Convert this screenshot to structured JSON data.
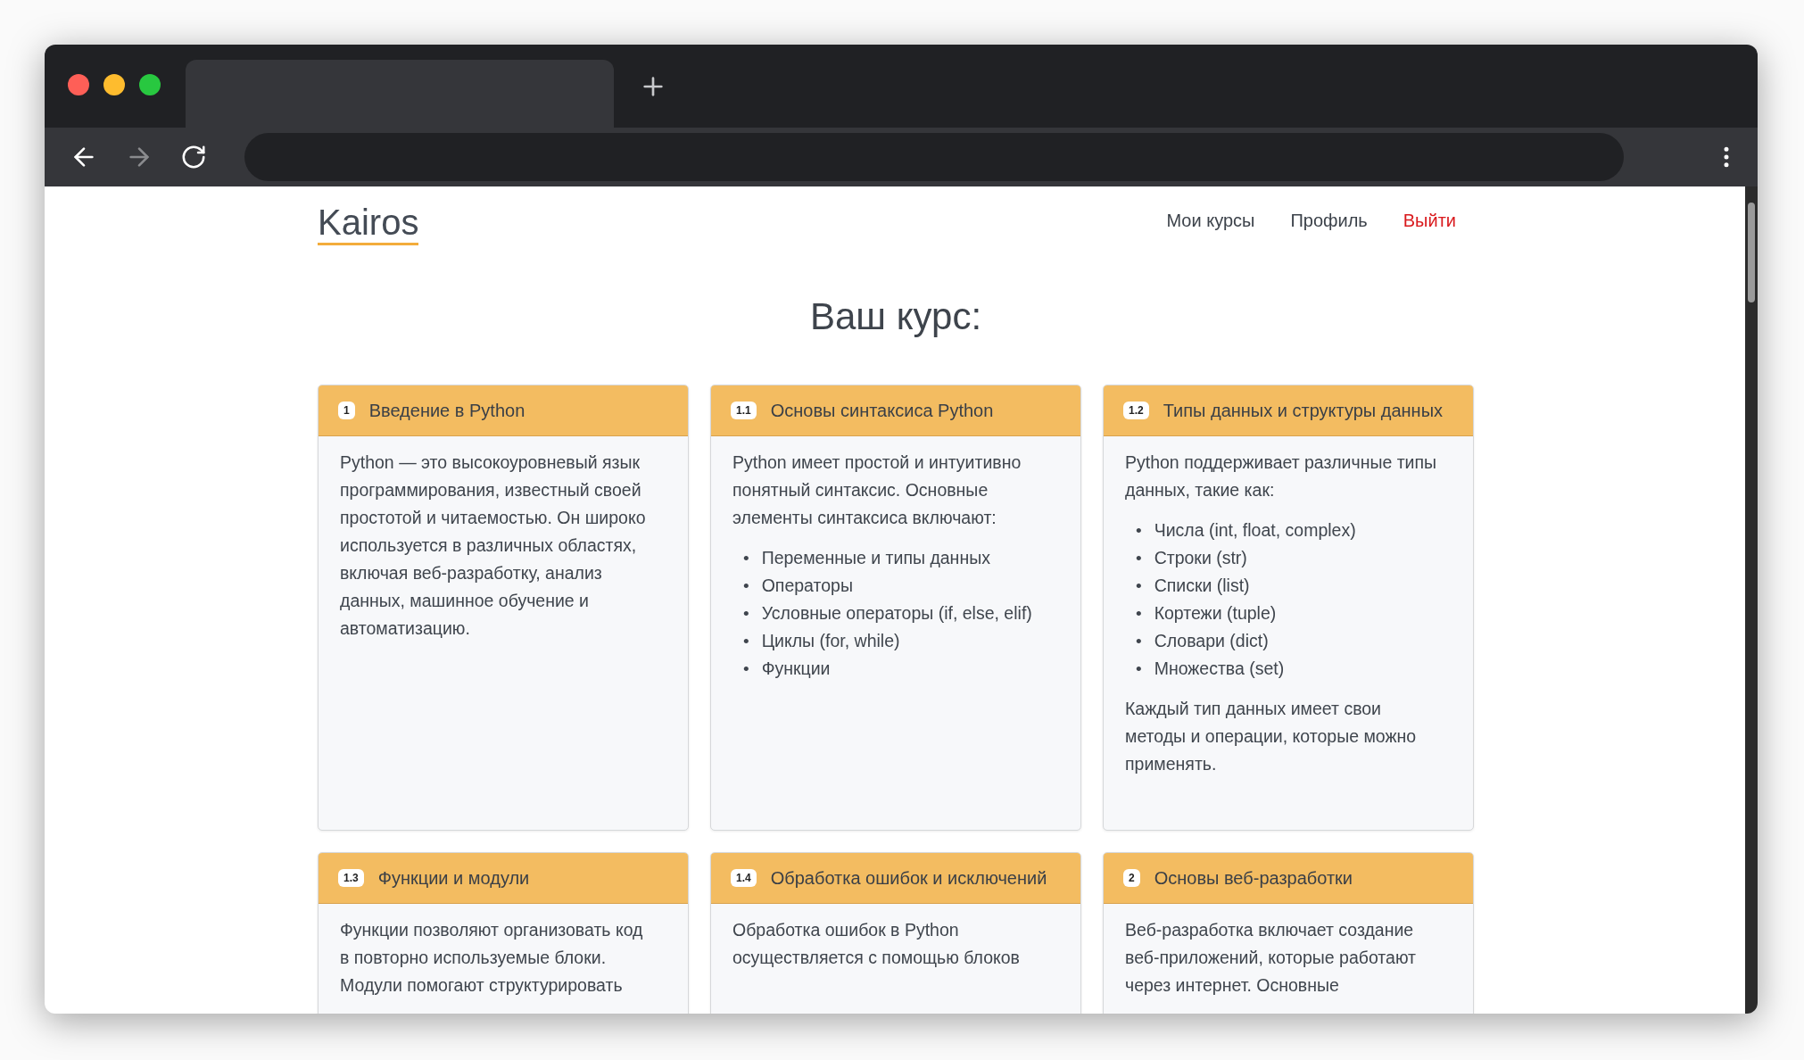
{
  "site": {
    "logo": "Kairos",
    "nav": [
      {
        "label": "Мои курсы",
        "kind": "link"
      },
      {
        "label": "Профиль",
        "kind": "link"
      },
      {
        "label": "Выйти",
        "kind": "logout"
      }
    ]
  },
  "heading": "Ваш курс:",
  "cards": [
    {
      "badge": "1",
      "title": "Введение в Python",
      "content": [
        {
          "kind": "paragraph",
          "lines": [
            "Python — это высокоуровневый язык",
            "программирования, известный своей",
            "простотой и читаемостью. Он широко",
            "используется в различных областях,",
            "включая веб-разработку, анализ",
            "данных, машинное обучение и",
            "автоматизацию."
          ]
        }
      ]
    },
    {
      "badge": "1.1",
      "title": "Основы синтаксиса Python",
      "content": [
        {
          "kind": "paragraph",
          "lines": [
            "Python имеет простой и интуитивно",
            "понятный синтаксис. Основные",
            "элементы синтаксиса включают:"
          ]
        },
        {
          "kind": "list",
          "marker": "•",
          "items": [
            "Переменные и типы данных",
            "Операторы",
            "Условные операторы (if, else, elif)",
            "Циклы (for, while)",
            "Функции"
          ]
        }
      ]
    },
    {
      "badge": "1.2",
      "title": "Типы данных и структуры данных",
      "content": [
        {
          "kind": "paragraph",
          "lines": [
            "Python поддерживает различные типы",
            "данных, такие как:"
          ]
        },
        {
          "kind": "list",
          "marker": "•",
          "items": [
            "Числа (int, float, complex)",
            "Строки (str)",
            "Списки (list)",
            "Кортежи (tuple)",
            "Словари (dict)",
            "Множества (set)"
          ]
        },
        {
          "kind": "paragraph",
          "lines": [
            "Каждый тип данных имеет свои",
            "методы и операции, которые можно",
            "применять."
          ]
        }
      ]
    },
    {
      "badge": "1.3",
      "title": "Функции и модули",
      "content": [
        {
          "kind": "paragraph",
          "lines": [
            "Функции позволяют организовать код",
            "в повторно используемые блоки.",
            "Модули помогают структурировать"
          ]
        }
      ]
    },
    {
      "badge": "1.4",
      "title": "Обработка ошибок и исключений",
      "content": [
        {
          "kind": "paragraph",
          "lines": [
            "Обработка ошибок в Python",
            "осуществляется с помощью блоков"
          ]
        }
      ]
    },
    {
      "badge": "2",
      "title": "Основы веб-разработки",
      "content": [
        {
          "kind": "paragraph",
          "lines": [
            "Веб-разработка включает создание",
            "веб-приложений, которые работают",
            "через интернет. Основные"
          ]
        }
      ]
    }
  ]
}
